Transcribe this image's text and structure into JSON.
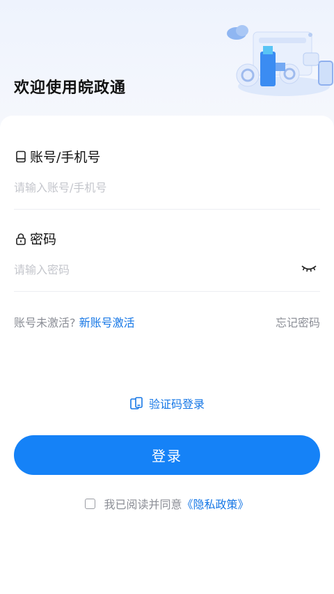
{
  "header": {
    "title": "欢迎使用皖政通",
    "illustration": "cloud-government-services-illustration"
  },
  "account": {
    "label": "账号/手机号",
    "icon": "phone-icon",
    "placeholder": "请输入账号/手机号",
    "value": ""
  },
  "password": {
    "label": "密码",
    "icon": "lock-icon",
    "placeholder": "请输入密码",
    "value": "",
    "toggle_icon": "eye-closed-icon"
  },
  "links": {
    "not_activated": "账号未激活?",
    "activate": "新账号激活",
    "forgot": "忘记密码"
  },
  "sms_login": {
    "label": "验证码登录",
    "icon": "sms-phone-icon"
  },
  "login_button": "登录",
  "agreement": {
    "text": "我已阅读并同意",
    "policy": "《隐私政策》",
    "checked": false
  },
  "colors": {
    "accent": "#1582f7",
    "link": "#1677e6",
    "placeholder": "#c4c6cc"
  }
}
